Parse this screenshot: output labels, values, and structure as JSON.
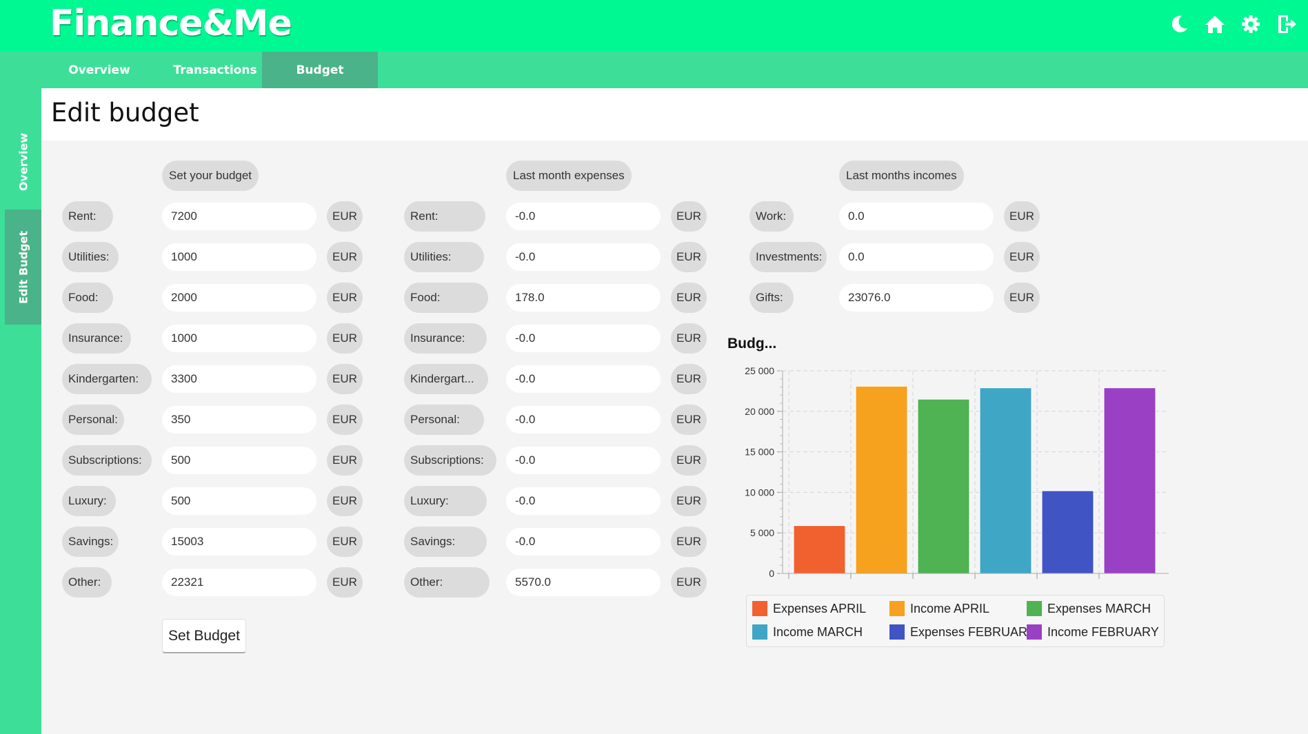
{
  "app": {
    "title": "Finance&Me"
  },
  "header_icons": [
    "moon-icon",
    "home-icon",
    "gear-icon",
    "logout-icon"
  ],
  "tabs": [
    {
      "label": "Overview",
      "active": false
    },
    {
      "label": "Transactions",
      "active": false
    },
    {
      "label": "Budget",
      "active": true
    }
  ],
  "sidebar": [
    {
      "label": "Overview",
      "active": false
    },
    {
      "label": "Edit Budget",
      "active": true
    }
  ],
  "page_title": "Edit budget",
  "budget": {
    "header": "Set your budget",
    "rows": [
      {
        "label": "Rent:",
        "value": "7200",
        "unit": "EUR"
      },
      {
        "label": "Utilities:",
        "value": "1000",
        "unit": "EUR"
      },
      {
        "label": "Food:",
        "value": "2000",
        "unit": "EUR"
      },
      {
        "label": "Insurance:",
        "value": "1000",
        "unit": "EUR"
      },
      {
        "label": "Kindergarten:",
        "value": "3300",
        "unit": "EUR"
      },
      {
        "label": "Personal:",
        "value": "350",
        "unit": "EUR"
      },
      {
        "label": "Subscriptions:",
        "value": "500",
        "unit": "EUR"
      },
      {
        "label": "Luxury:",
        "value": "500",
        "unit": "EUR"
      },
      {
        "label": "Savings:",
        "value": "15003",
        "unit": "EUR"
      },
      {
        "label": "Other:",
        "value": "22321",
        "unit": "EUR"
      }
    ],
    "button": "Set Budget"
  },
  "expenses": {
    "header": "Last month expenses",
    "rows": [
      {
        "label": "Rent:",
        "value": "-0.0",
        "unit": "EUR"
      },
      {
        "label": "Utilities:",
        "value": "-0.0",
        "unit": "EUR"
      },
      {
        "label": "Food:",
        "value": "178.0",
        "unit": "EUR"
      },
      {
        "label": "Insurance:",
        "value": "-0.0",
        "unit": "EUR"
      },
      {
        "label": "Kindergart...",
        "value": "-0.0",
        "unit": "EUR"
      },
      {
        "label": "Personal:",
        "value": "-0.0",
        "unit": "EUR"
      },
      {
        "label": "Subscriptions:",
        "value": "-0.0",
        "unit": "EUR"
      },
      {
        "label": "Luxury:",
        "value": "-0.0",
        "unit": "EUR"
      },
      {
        "label": "Savings:",
        "value": "-0.0",
        "unit": "EUR"
      },
      {
        "label": "Other:",
        "value": "5570.0",
        "unit": "EUR"
      }
    ]
  },
  "incomes": {
    "header": "Last months incomes",
    "rows": [
      {
        "label": "Work:",
        "value": "0.0",
        "unit": "EUR"
      },
      {
        "label": "Investments:",
        "value": "0.0",
        "unit": "EUR"
      },
      {
        "label": "Gifts:",
        "value": "23076.0",
        "unit": "EUR"
      }
    ]
  },
  "chart_data": {
    "type": "bar",
    "title": "Budg...",
    "ylim": [
      0,
      25000
    ],
    "yticks": [
      0,
      5000,
      10000,
      15000,
      20000,
      25000
    ],
    "ytick_labels": [
      "0",
      "5 000",
      "10 000",
      "15 000",
      "20 000",
      "25 000"
    ],
    "grid": true,
    "legend_position": "bottom",
    "series": [
      {
        "name": "Expenses APRIL",
        "value": 5900,
        "color": "#f0612f"
      },
      {
        "name": "Income APRIL",
        "value": 23100,
        "color": "#f6a21e"
      },
      {
        "name": "Expenses MARCH",
        "value": 21500,
        "color": "#4fb253"
      },
      {
        "name": "Income MARCH",
        "value": 22900,
        "color": "#3fa6c6"
      },
      {
        "name": "Expenses FEBRUARY",
        "value": 10200,
        "color": "#4054c4"
      },
      {
        "name": "Income FEBRUARY",
        "value": 22900,
        "color": "#9a40c4"
      }
    ]
  }
}
